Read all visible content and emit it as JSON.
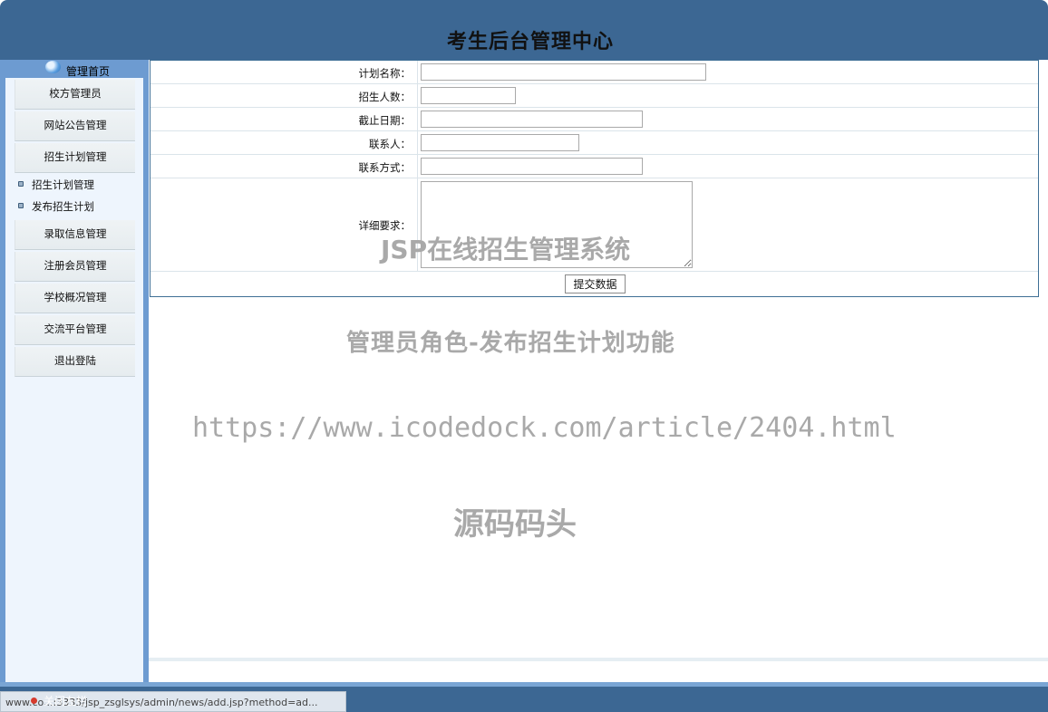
{
  "header": {
    "title": "考生后台管理中心"
  },
  "sidebar": {
    "home_label": "管理首页",
    "items": [
      {
        "label": "校方管理员"
      },
      {
        "label": "网站公告管理"
      },
      {
        "label": "招生计划管理"
      },
      {
        "label": "录取信息管理"
      },
      {
        "label": "注册会员管理"
      },
      {
        "label": "学校概况管理"
      },
      {
        "label": "交流平台管理"
      },
      {
        "label": "退出登陆"
      }
    ],
    "subitems": [
      {
        "label": "招生计划管理"
      },
      {
        "label": "发布招生计划"
      }
    ]
  },
  "form": {
    "fields": [
      {
        "label": "计划名称：",
        "value": ""
      },
      {
        "label": "招生人数：",
        "value": ""
      },
      {
        "label": "截止日期：",
        "value": ""
      },
      {
        "label": "联系人：",
        "value": ""
      },
      {
        "label": "联系方式：",
        "value": ""
      },
      {
        "label": "详细要求：",
        "value": ""
      }
    ],
    "submit_label": "提交数据"
  },
  "watermarks": {
    "line1": "JSP在线招生管理系统",
    "line2": "管理员角色-发布招生计划功能",
    "line3": "https://www.icodedock.com/article/2404.html",
    "line4": "源码码头"
  },
  "footer": {
    "close_left_label": "关闭左栏",
    "status_url": "www.co...:3333/jsp_zsglsys/admin/news/add.jsp?method=ad..."
  },
  "colors": {
    "header_bg": "#3c6793",
    "sidebar_bg": "#6d9bd1",
    "menu_bg": "#eef5fd",
    "watermark": "#a9a9a9"
  }
}
